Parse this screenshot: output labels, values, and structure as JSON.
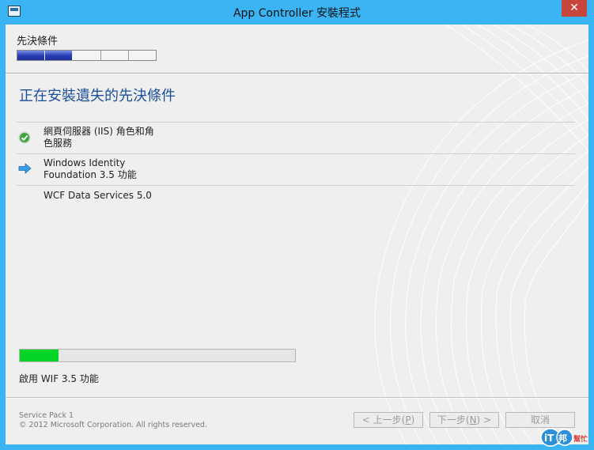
{
  "window": {
    "title": "App Controller 安裝程式",
    "close_glyph": "✕"
  },
  "steps": {
    "label": "先決條件",
    "total": 5,
    "completed": 2
  },
  "page": {
    "title": "正在安裝遺失的先決條件"
  },
  "items": [
    {
      "line1": "網頁伺服器 (IIS) 角色和角",
      "line2": "色服務",
      "status": "done",
      "icon": "check-icon"
    },
    {
      "line1": "Windows Identity",
      "line2": "Foundation 3.5 功能",
      "status": "current",
      "icon": "arrow-right-icon"
    },
    {
      "line1": "WCF Data Services 5.0",
      "line2": "",
      "status": "pending",
      "icon": ""
    }
  ],
  "progress": {
    "fraction": 0.14,
    "status_text": "啟用 WIF 3.5 功能",
    "color": "#06d427"
  },
  "footer": {
    "line1": "Service Pack 1",
    "line2": "© 2012 Microsoft Corporation. All rights reserved."
  },
  "buttons": {
    "back": {
      "pre": "< 上一步(",
      "key": "P",
      "post": ")"
    },
    "next": {
      "pre": "下一步(",
      "key": "N",
      "post": ") >"
    },
    "cancel": "取消"
  },
  "watermark": {
    "text": "iT邦幫忙"
  },
  "colors": {
    "accent": "#3ab4f2",
    "title_text": "#1e4f9a",
    "close": "#c7453b"
  }
}
